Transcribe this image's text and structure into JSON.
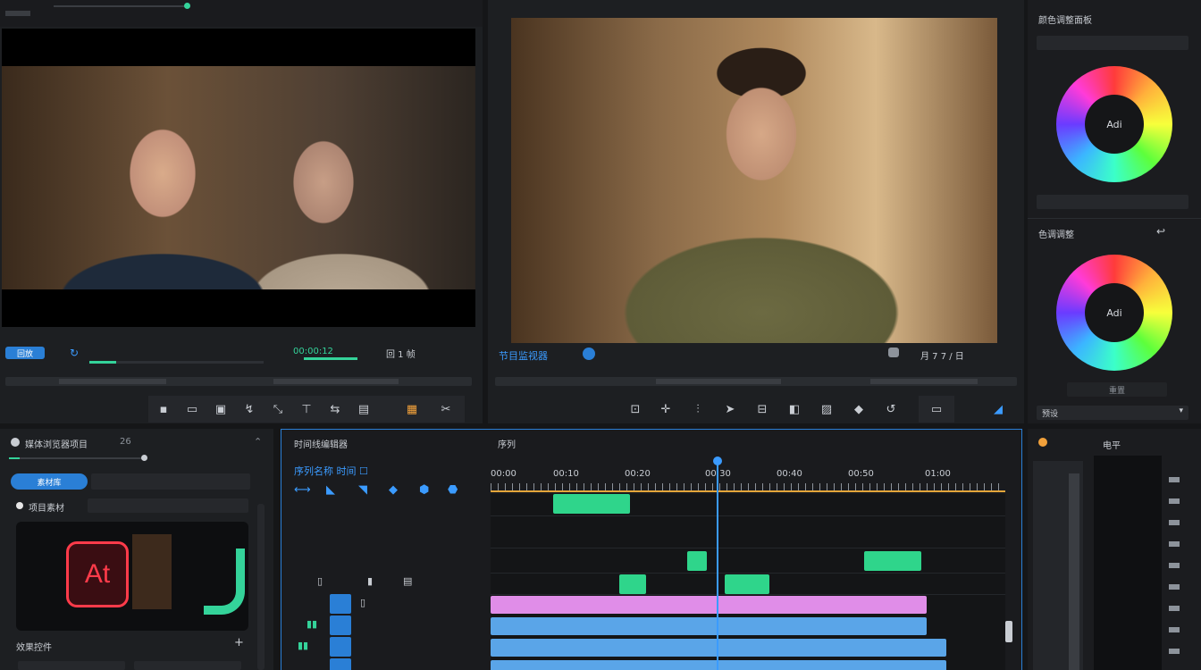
{
  "colors": {
    "accent": "#3b9bff",
    "green": "#34d39a",
    "pink": "#e08de8",
    "clip_blue": "#5aa5e8"
  },
  "source_monitor": {
    "tag": "回放",
    "timecode": "00:00:12",
    "right_label": "回 1 帧",
    "toolbar_icons": [
      "clip-icon",
      "lift-icon",
      "extract-icon",
      "insert-icon",
      "overwrite-icon",
      "mark-in-icon",
      "mark-out-icon",
      "export-frame-icon",
      "render-icon",
      "tools-icon"
    ]
  },
  "program_monitor": {
    "label": "节目监视器",
    "right_label": "月 7 7 / 日",
    "toolbar_icons": [
      "crop-icon",
      "move-icon",
      "split-icon",
      "cursor-icon",
      "frame-icon",
      "camera-icon",
      "snapshot-icon",
      "mask-icon",
      "undo-icon",
      "monitor-icon",
      "settings-icon"
    ]
  },
  "color_panel": {
    "title": "颜色调整面板",
    "wheel1_label": "Adi",
    "wheel2_label": "Adi",
    "section2_title": "色调调整",
    "reset_label": "重置",
    "preset_label": "预设"
  },
  "media_browser": {
    "title": "媒体浏览器项目",
    "count": "26",
    "tab_label": "素材库",
    "subtitle": "项目素材",
    "footer_label": "效果控件",
    "add_label": "+",
    "thumb_logo": "At"
  },
  "timeline": {
    "title": "时间线编辑器",
    "sequence": "序列",
    "tools_label": "序列名称 时间 ☐",
    "ruler": [
      "00:00",
      "00:10",
      "00:20",
      "00:30",
      "00:40",
      "00:50",
      "01:00"
    ]
  },
  "audio_meter": {
    "icon": "speaker-icon",
    "label": "电平"
  }
}
